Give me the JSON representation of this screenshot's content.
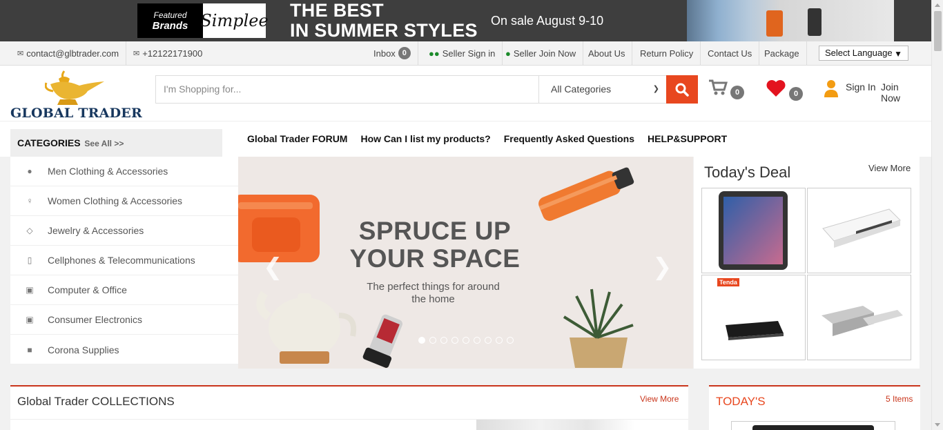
{
  "banner": {
    "featured_small": "Featured",
    "featured_brands": "Brands",
    "brand_name": "Simplee",
    "headline_line1": "THE BEST",
    "headline_line2": "IN SUMMER STYLES",
    "sale_text": "On sale August 9-10"
  },
  "contact_bar": {
    "email": "contact@glbtrader.com",
    "phone": "+12122171900",
    "inbox_label": "Inbox",
    "inbox_count": "0",
    "seller_sign_in": "Seller Sign in",
    "seller_join_now": "Seller Join Now",
    "about_us": "About Us",
    "return_policy": "Return Policy",
    "contact_us": "Contact Us",
    "package": "Package",
    "language_select": "Select Language"
  },
  "header": {
    "logo_text": "GLOBAL TRADER",
    "search_placeholder": "I'm Shopping for...",
    "category_select": "All Categories",
    "cart_count": "0",
    "wishlist_count": "0",
    "sign_in": "Sign In",
    "join_now": "Join Now"
  },
  "categories": {
    "header": "CATEGORIES",
    "see_all": "See All >>",
    "items": [
      {
        "label": "Men Clothing & Accessories",
        "icon": "user-icon"
      },
      {
        "label": "Women Clothing & Accessories",
        "icon": "female-icon"
      },
      {
        "label": "Jewelry & Accessories",
        "icon": "diamond-icon"
      },
      {
        "label": "Cellphones & Telecommunications",
        "icon": "mobile-icon"
      },
      {
        "label": "Computer & Office",
        "icon": "desktop-icon"
      },
      {
        "label": "Consumer Electronics",
        "icon": "camera-icon"
      },
      {
        "label": "Corona Supplies",
        "icon": "truck-icon"
      }
    ]
  },
  "nav": {
    "forum": "Global Trader FORUM",
    "list_products": "How Can I list my products?",
    "faq": "Frequently Asked Questions",
    "help": "HELP&SUPPORT"
  },
  "slider": {
    "headline_line1": "SPRUCE UP",
    "headline_line2": "YOUR SPACE",
    "sub_line1": "The perfect things for around",
    "sub_line2": "the home",
    "slide_count": 9,
    "active_slide": 1
  },
  "deal": {
    "title": "Today's Deal",
    "view_more": "View More",
    "brand_tag": "Tenda"
  },
  "collections": {
    "title": "Global Trader COLLECTIONS",
    "view_more": "View More"
  },
  "today": {
    "title": "TODAY'S",
    "items": "5 Items"
  },
  "colors": {
    "accent": "#e8471f",
    "section_border": "#c9341a",
    "logo_navy": "#17375e",
    "lamp_gold": "#e7a81a",
    "user_orange": "#f39c12",
    "wishlist_red": "#e3131f"
  }
}
